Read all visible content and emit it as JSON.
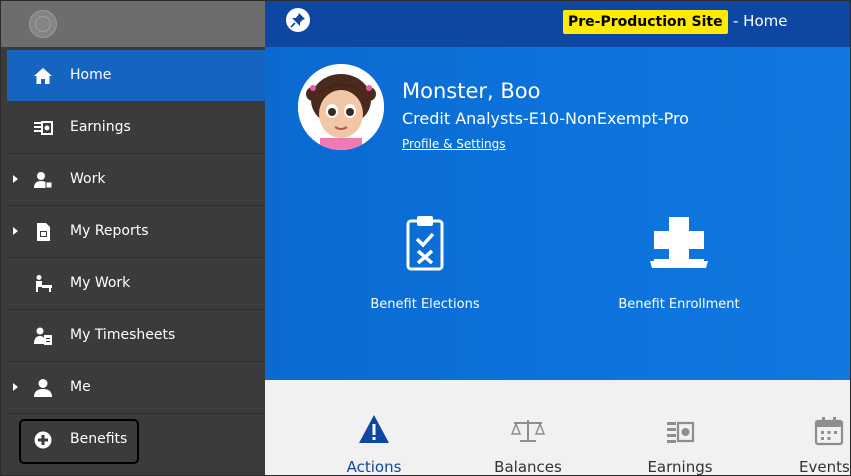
{
  "header": {
    "badge": "Pre-Production Site",
    "page_suffix": "- Home"
  },
  "sidebar": {
    "items": [
      {
        "label": "Home",
        "icon": "home-icon",
        "expandable": false,
        "active": true
      },
      {
        "label": "Earnings",
        "icon": "earnings-icon",
        "expandable": false,
        "active": false
      },
      {
        "label": "Work",
        "icon": "work-icon",
        "expandable": true,
        "active": false
      },
      {
        "label": "My Reports",
        "icon": "reports-icon",
        "expandable": true,
        "active": false
      },
      {
        "label": "My Work",
        "icon": "my-work-icon",
        "expandable": false,
        "active": false
      },
      {
        "label": "My Timesheets",
        "icon": "timesheets-icon",
        "expandable": false,
        "active": false
      },
      {
        "label": "Me",
        "icon": "user-icon",
        "expandable": true,
        "active": false
      },
      {
        "label": "Benefits",
        "icon": "plus-circle-icon",
        "expandable": false,
        "active": false,
        "highlighted": true
      }
    ]
  },
  "profile": {
    "name": "Monster, Boo",
    "title": "Credit Analysts-E10-NonExempt-Pro",
    "link": "Profile & Settings"
  },
  "tiles": [
    {
      "label": "Benefit Elections",
      "icon": "clipboard-check-icon"
    },
    {
      "label": "Benefit Enrollment",
      "icon": "medical-cross-icon"
    }
  ],
  "bottom_tabs": [
    {
      "label": "Actions",
      "icon": "warning-icon",
      "active": true
    },
    {
      "label": "Balances",
      "icon": "scale-icon",
      "active": false
    },
    {
      "label": "Earnings",
      "icon": "earnings-icon",
      "active": false
    },
    {
      "label": "Events",
      "icon": "calendar-icon",
      "active": false
    }
  ],
  "colors": {
    "header": "#0d47a1",
    "hero": "#0c72dc",
    "sidebar": "#3b3b3b",
    "active_item": "#1565c0",
    "badge": "#ffeb00",
    "active_tab": "#0d47a1"
  }
}
